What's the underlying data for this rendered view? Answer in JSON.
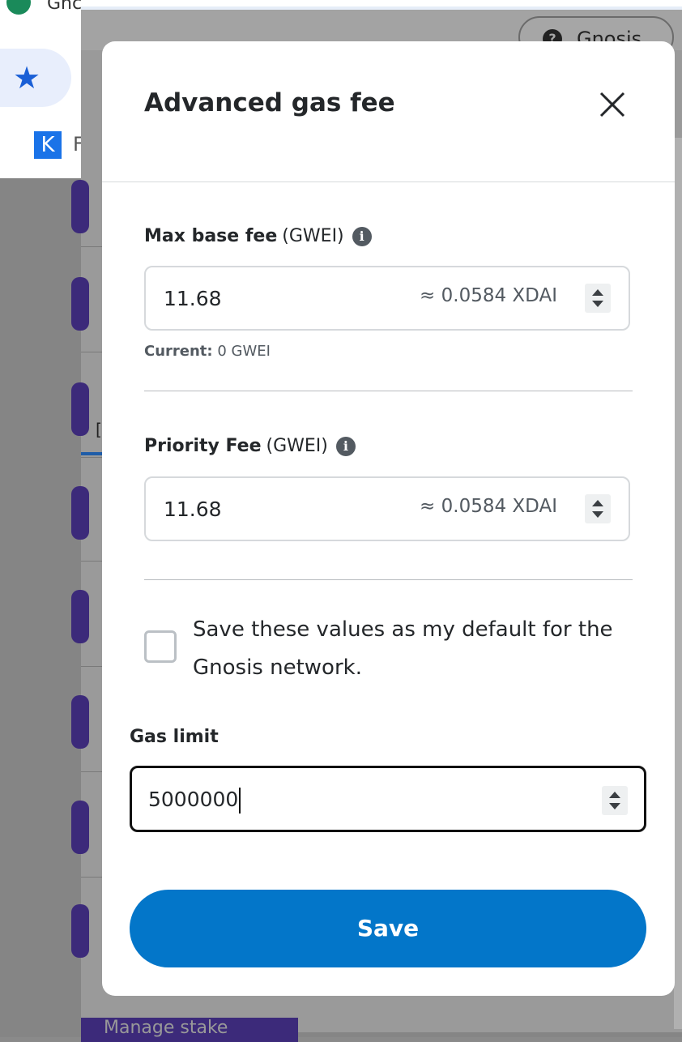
{
  "browser": {
    "tab_title": "Gnc",
    "bookmark_letter": "K",
    "bookmark_label": "F",
    "star_icon": "star-icon"
  },
  "extension": {
    "network_label": "Gnosis",
    "side_letter": "[",
    "bottom_text": "Manage stake"
  },
  "modal": {
    "title": "Advanced gas fee",
    "close_icon": "close-icon",
    "max_base_fee": {
      "label": "Max base fee",
      "unit": "(GWEI)",
      "value": "11.68",
      "approx": "≈ 0.0584 XDAI",
      "current_label": "Current:",
      "current_value": "0 GWEI"
    },
    "priority_fee": {
      "label": "Priority Fee",
      "unit": "(GWEI)",
      "value": "11.68",
      "approx": "≈ 0.0584 XDAI"
    },
    "save_default": {
      "checked": false,
      "label": "Save these values as my default for the Gnosis network."
    },
    "gas_limit": {
      "label": "Gas limit",
      "value": "5000000"
    },
    "save_label": "Save"
  }
}
